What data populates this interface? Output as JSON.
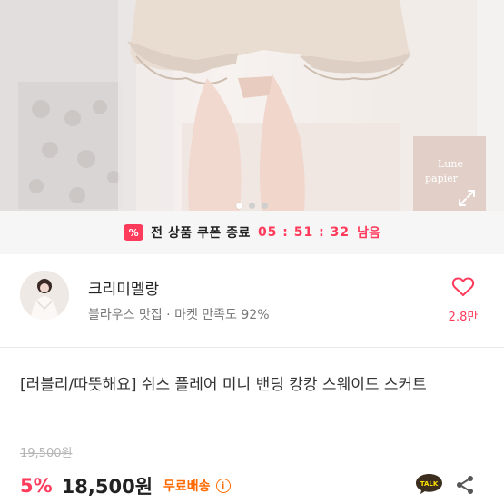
{
  "photo": {
    "alt_icon": "expand-icon"
  },
  "carousel": {
    "count": 3,
    "active": 0
  },
  "coupon": {
    "icon_glyph": "%",
    "text": "전 상품 쿠폰 종료",
    "timer": "05 : 51 : 32",
    "suffix": "남음"
  },
  "shop": {
    "name": "크리미멜랑",
    "description": "블라우스 맛집 · 마켓 만족도 92%",
    "like_count": "2.8만"
  },
  "product": {
    "title": "[러블리/따뜻해요] 쉬스 플레어 미니 밴딩 캉캉 스웨이드 스커트",
    "original_price": "19,500원",
    "discount": "5%",
    "price": "18,500원",
    "shipping": "무료배송",
    "info_glyph": "i"
  },
  "actions": {
    "talk_label": "TALK"
  },
  "colors": {
    "accent": "#ff3b5c",
    "shipping": "#ff6a00"
  }
}
